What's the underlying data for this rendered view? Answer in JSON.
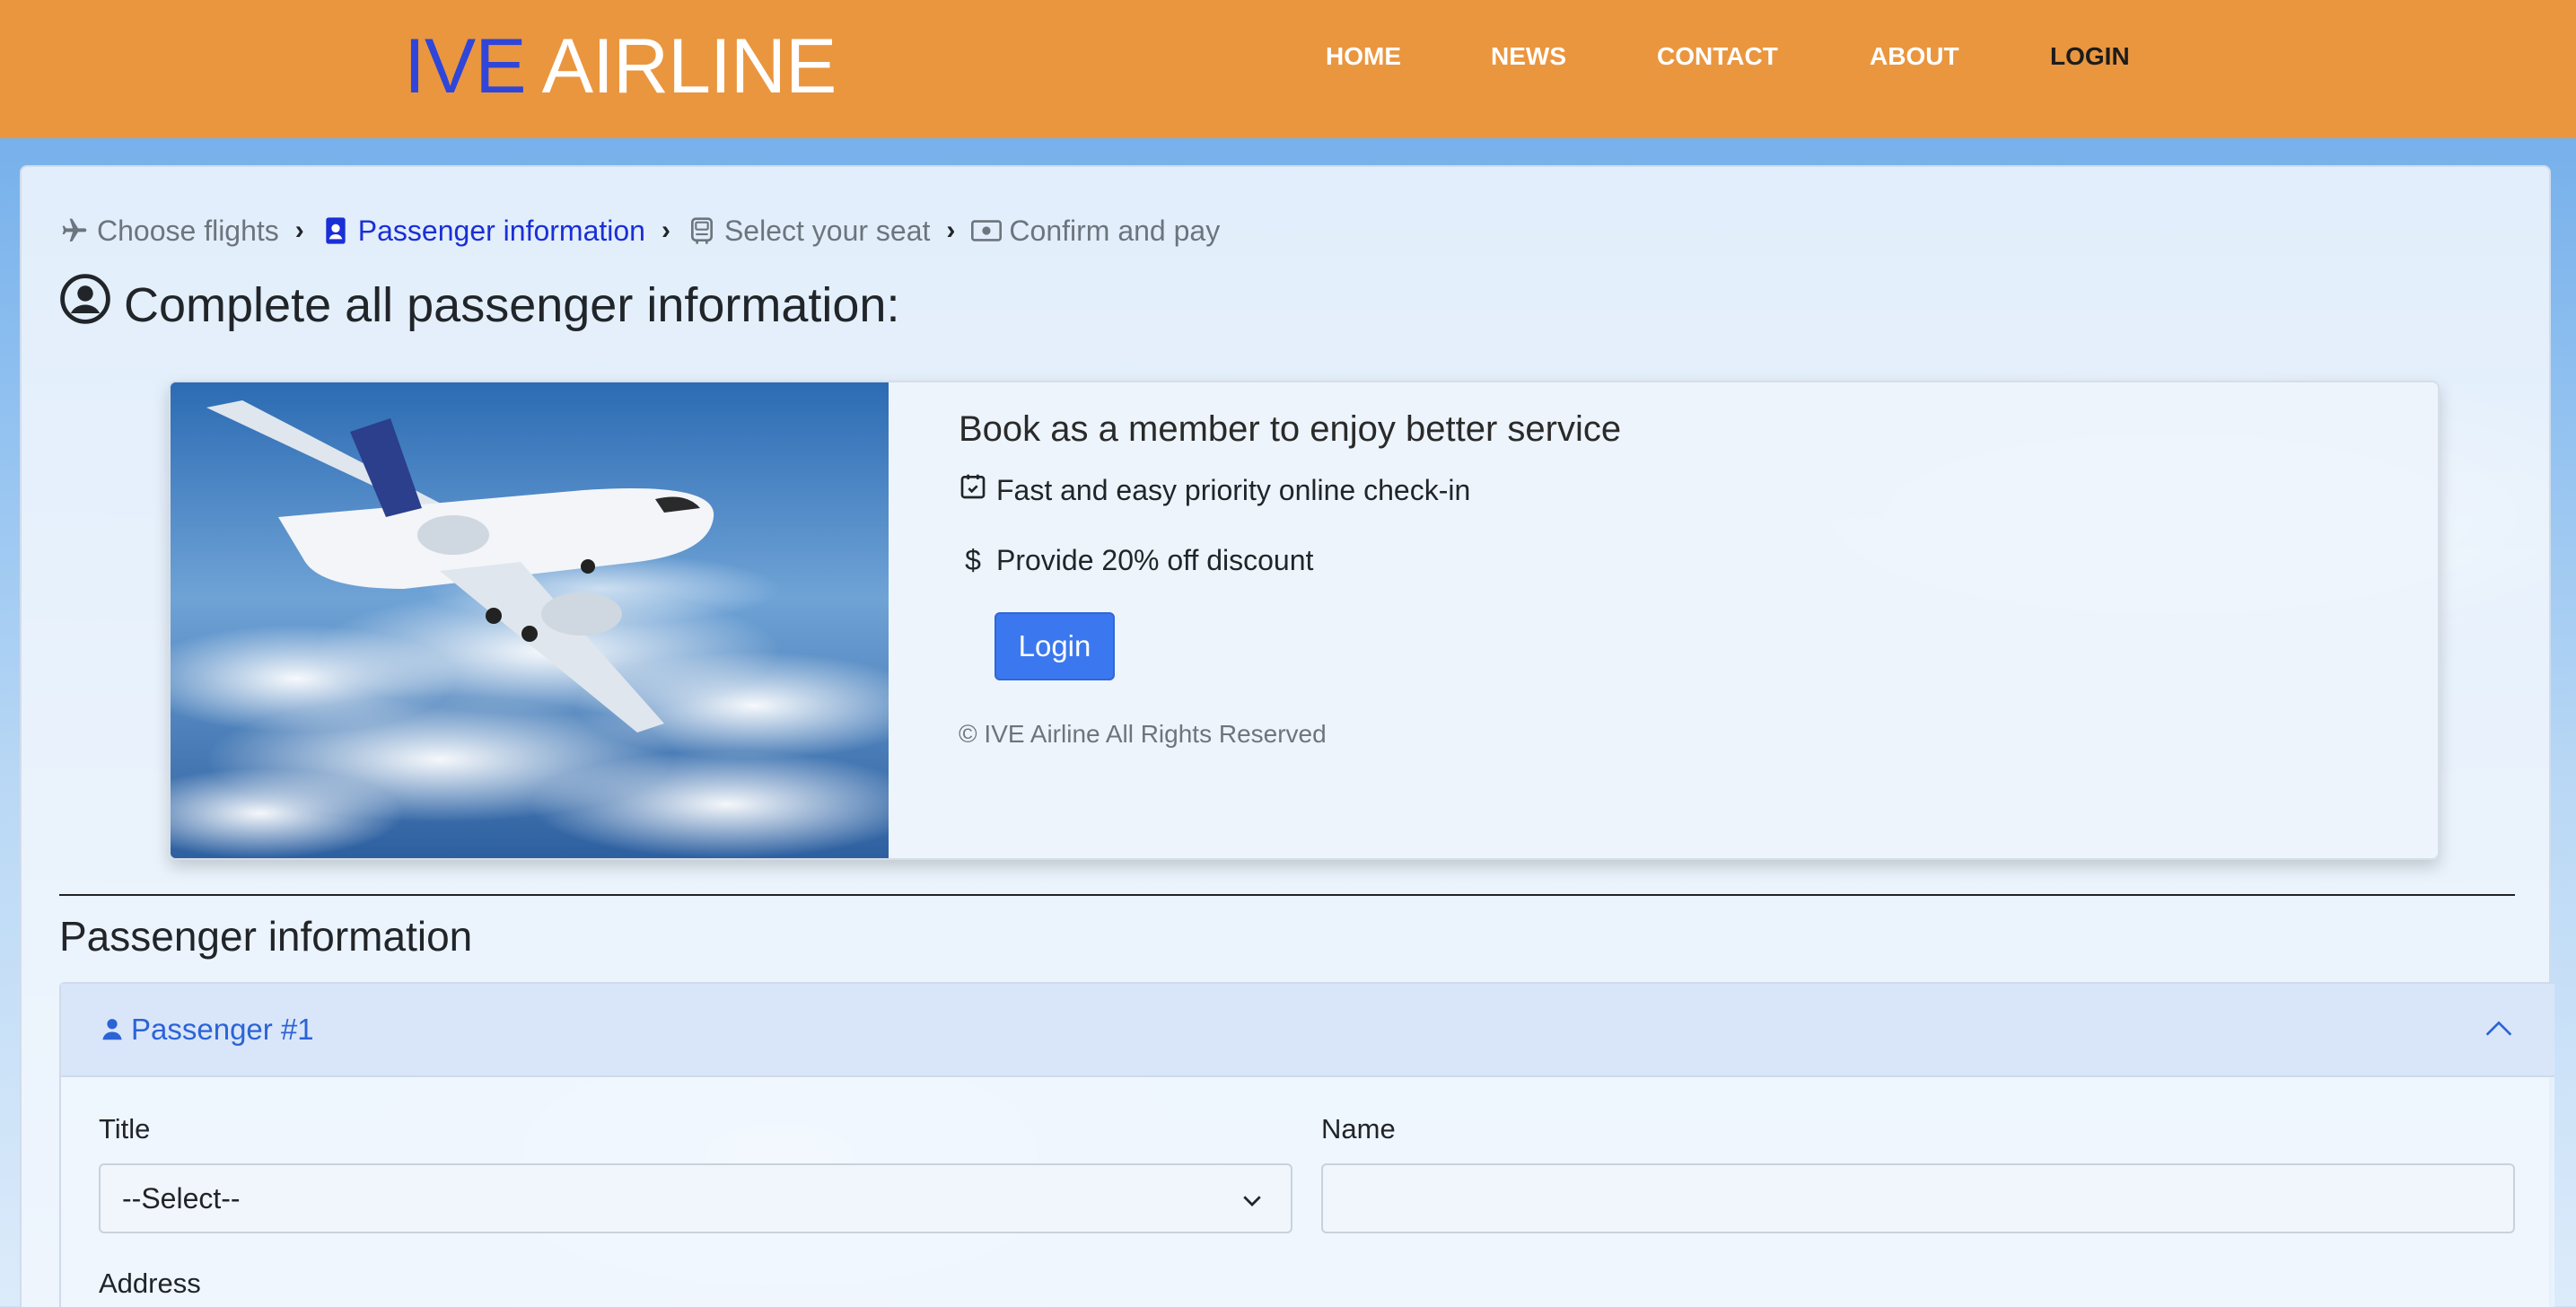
{
  "brand": {
    "part1": "IVE",
    "part2": "AIRLINE"
  },
  "nav": {
    "items": [
      "HOME",
      "NEWS",
      "CONTACT",
      "ABOUT",
      "LOGIN"
    ],
    "active": "LOGIN"
  },
  "breadcrumb": [
    {
      "label": "Choose flights",
      "icon": "plane-icon",
      "active": false
    },
    {
      "label": "Passenger information",
      "icon": "id-badge-icon",
      "active": true
    },
    {
      "label": "Select your seat",
      "icon": "seat-icon",
      "active": false
    },
    {
      "label": "Confirm and pay",
      "icon": "cash-icon",
      "active": false
    }
  ],
  "page_title": "Complete all passenger information:",
  "promo": {
    "title": "Book as a member to enjoy better service",
    "features": [
      {
        "icon": "calendar-check-icon",
        "text": "Fast and easy priority online check-in"
      },
      {
        "icon": "dollar-icon",
        "text": "Provide 20% off discount"
      }
    ],
    "login_label": "Login",
    "copyright": "© IVE Airline All Rights Reserved"
  },
  "section_title": "Passenger information",
  "passenger": {
    "header": "Passenger #1",
    "title_label": "Title",
    "title_value": "--Select--",
    "name_label": "Name",
    "name_value": "",
    "address_label": "Address"
  },
  "colors": {
    "header": "#ea963f",
    "brand_blue": "#2f46d8",
    "accent": "#3b78ef"
  }
}
